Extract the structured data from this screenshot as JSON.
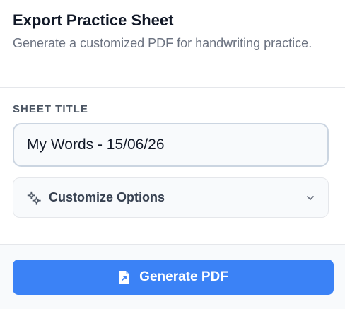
{
  "dialog": {
    "title": "Export Practice Sheet",
    "subtitle": "Generate a customized PDF for handwriting practice."
  },
  "sheet_title": {
    "label": "SHEET TITLE",
    "value": "My Words - 15/06/26"
  },
  "options": {
    "label": "Customize Options",
    "icon": "gears-icon",
    "expand_icon": "chevron-down-icon"
  },
  "footer": {
    "generate_label": "Generate PDF",
    "generate_icon": "file-export-icon"
  },
  "colors": {
    "accent": "#3b82f6",
    "title": "#111827",
    "muted": "#6b7280"
  }
}
